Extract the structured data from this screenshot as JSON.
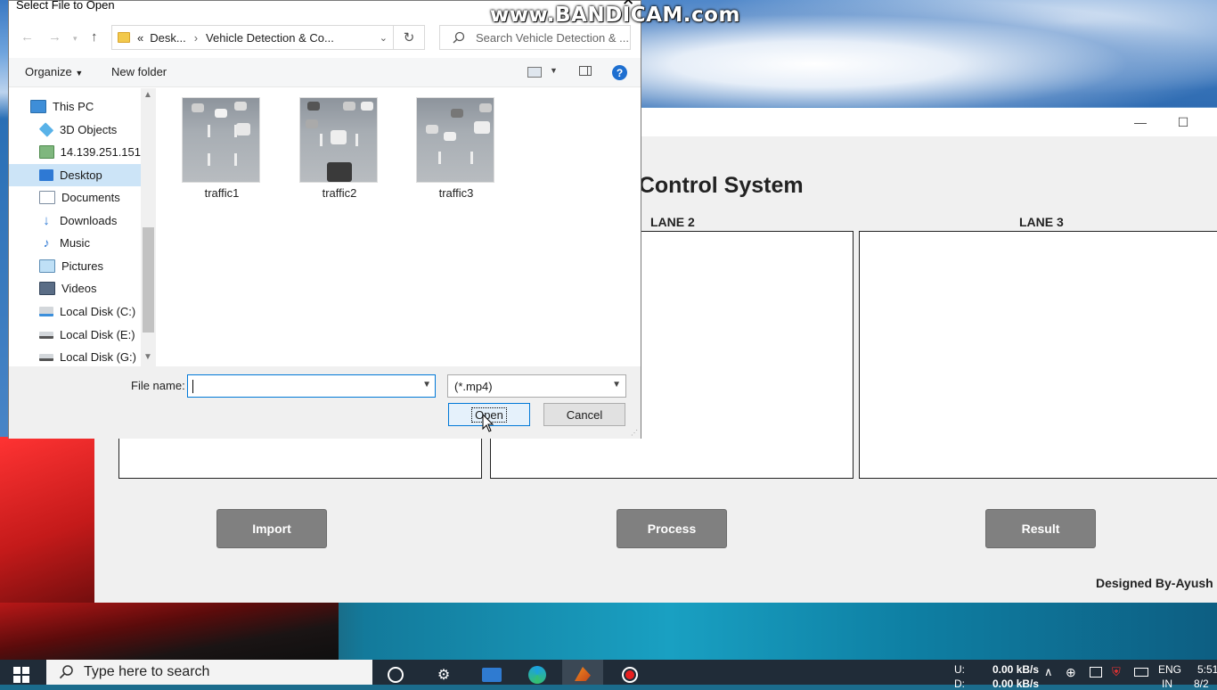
{
  "watermark": "www.BANDICAM.com",
  "app": {
    "title": "c Control System",
    "lanes": [
      "LANE 2",
      "LANE 3"
    ],
    "buttons": {
      "import": "Import",
      "process": "Process",
      "result": "Result"
    },
    "credits": "Designed By-Ayush Gu",
    "window_controls": {
      "minimize": "—",
      "maximize": "☐"
    }
  },
  "dialog": {
    "title": "Select File to Open",
    "breadcrumb": {
      "prefix": "«",
      "items": [
        "Desk...",
        "Vehicle Detection & Co..."
      ]
    },
    "search_placeholder": "Search Vehicle Detection & ...",
    "toolbar": {
      "organize": "Organize",
      "new_folder": "New folder",
      "help": "?"
    },
    "nav": [
      {
        "label": "This PC",
        "icon": "computer-icon"
      },
      {
        "label": "3D Objects",
        "icon": "cube-icon"
      },
      {
        "label": "14.139.251.151",
        "icon": "network-drive-icon"
      },
      {
        "label": "Desktop",
        "icon": "desktop-icon",
        "selected": true
      },
      {
        "label": "Documents",
        "icon": "documents-icon"
      },
      {
        "label": "Downloads",
        "icon": "download-icon"
      },
      {
        "label": "Music",
        "icon": "music-icon"
      },
      {
        "label": "Pictures",
        "icon": "pictures-icon"
      },
      {
        "label": "Videos",
        "icon": "videos-icon"
      },
      {
        "label": "Local Disk (C:)",
        "icon": "drive-icon"
      },
      {
        "label": "Local Disk (E:)",
        "icon": "drive-icon"
      },
      {
        "label": "Local Disk (G:)",
        "icon": "drive-icon"
      }
    ],
    "files": [
      "traffic1",
      "traffic2",
      "traffic3"
    ],
    "file_name_label": "File name:",
    "file_name_value": "",
    "file_type": "(*.mp4)",
    "open_label": "Open",
    "cancel_label": "Cancel"
  },
  "taskbar": {
    "search_placeholder": "Type here to search",
    "net_up_label": "U:",
    "net_down_label": "D:",
    "net_speed": "0.00 kB/s",
    "net_speed2": "0.00 kB/s",
    "lang": "ENG",
    "lang2": "IN",
    "time": "5:51",
    "date": "8/2"
  },
  "colors": {
    "accent": "#0078d7",
    "app_button": "#808080",
    "taskbar": "#202c38"
  }
}
